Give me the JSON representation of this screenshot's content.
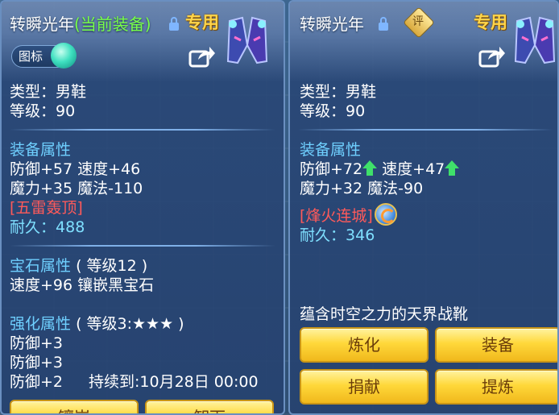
{
  "left_panel": {
    "title": "转瞬光年",
    "title_tag": "(当前装备)",
    "exclusive": "专用",
    "icon_label": "图标",
    "type_line": "类型：男鞋",
    "level_line": "等级：90",
    "equip_attr_heading": "装备属性",
    "attr_line1": "防御+57 速度+46",
    "attr_line2": "魔力+35 魔法-110",
    "special_skill": "[五雷轰顶]",
    "durability_label": "耐久：",
    "durability_value": "488",
    "gem_heading": "宝石属性",
    "gem_level": "( 等级12 )",
    "gem_line": "速度+96 镶嵌黑宝石",
    "enhance_heading": "强化属性",
    "enhance_level": "( 等级3:★★★ )",
    "enhance_lines": [
      "防御+3",
      "防御+3",
      "防御+2"
    ],
    "enhance_duration": "持续到:10月28日 00:00",
    "buttons": [
      "镶嵌",
      "卸下"
    ]
  },
  "right_panel": {
    "title": "转瞬光年",
    "rating_label": "评",
    "exclusive": "专用",
    "type_line": "类型：男鞋",
    "level_line": "等级：90",
    "equip_attr_heading": "装备属性",
    "attr_defense": "防御+72",
    "attr_speed": "速度+47",
    "attr_line2": "魔力+32 魔法-90",
    "special_skill": "[烽火连城]",
    "durability_label": "耐久：",
    "durability_value": "346",
    "description": "蕴含时空之力的天界战靴",
    "buttons": [
      "炼化",
      "装备",
      "捐献",
      "提炼"
    ]
  },
  "colors": {
    "title_tag_green": "#78ff4a",
    "section_blue": "#6fd0ff",
    "skill_red": "#ff5a5a",
    "button_gold": "#ffd83a"
  }
}
